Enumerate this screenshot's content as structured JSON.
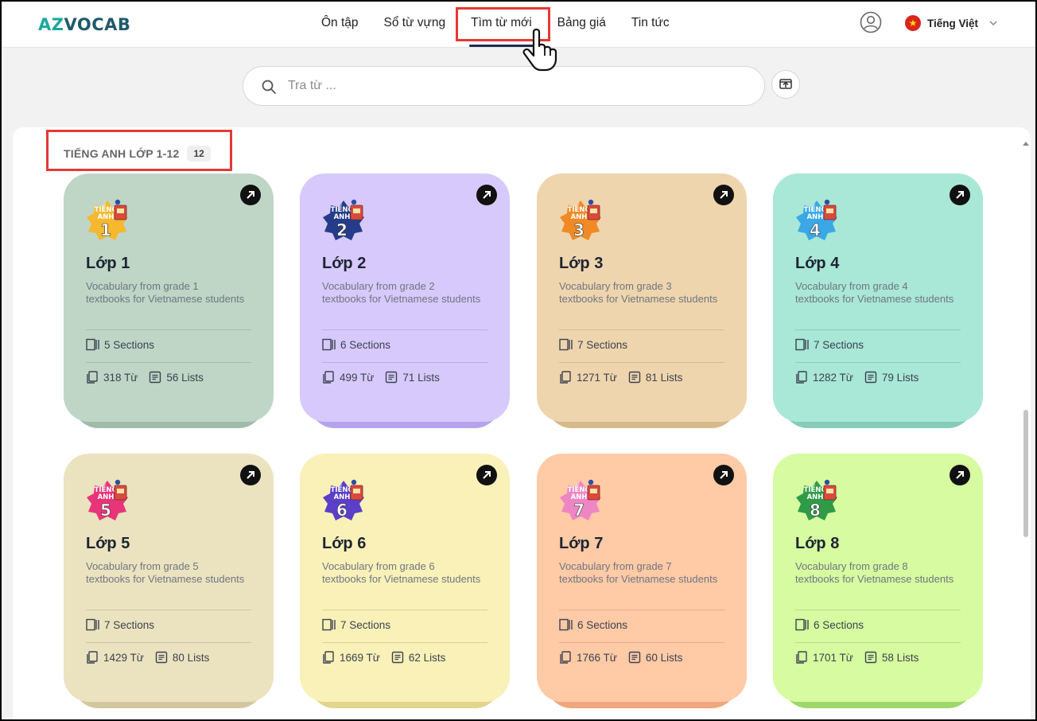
{
  "header": {
    "logo": "AZVOCAB",
    "nav": [
      {
        "label": "Ôn tập"
      },
      {
        "label": "Sổ từ vựng"
      },
      {
        "label": "Tìm từ mới",
        "active": true
      },
      {
        "label": "Bảng giá"
      },
      {
        "label": "Tin tức"
      }
    ],
    "language": "Tiếng Việt"
  },
  "search": {
    "placeholder": "Tra từ ..."
  },
  "section": {
    "title": "TIẾNG ANH LỚP 1-12",
    "count": "12"
  },
  "cards": [
    {
      "title": "Lớp 1",
      "grade": "1",
      "desc": "Vocabulary from grade 1 textbooks for Vietnamese students",
      "sections": "5 Sections",
      "words": "318 Từ",
      "lists": "56 Lists",
      "color": "#bfd6c6",
      "shadow": "#9fbba9",
      "badge": "#f5b82e"
    },
    {
      "title": "Lớp 2",
      "grade": "2",
      "desc": "Vocabulary from grade 2 textbooks for Vietnamese students",
      "sections": "6 Sections",
      "words": "499 Từ",
      "lists": "71 Lists",
      "color": "#d7c9fb",
      "shadow": "#b6a3ee",
      "badge": "#243c8a"
    },
    {
      "title": "Lớp 3",
      "grade": "3",
      "desc": "Vocabulary from grade 3 textbooks for Vietnamese students",
      "sections": "7 Sections",
      "words": "1271 Từ",
      "lists": "81 Lists",
      "color": "#efd5ad",
      "shadow": "#d8b98a",
      "badge": "#f08a24"
    },
    {
      "title": "Lớp 4",
      "grade": "4",
      "desc": "Vocabulary from grade 4 textbooks for Vietnamese students",
      "sections": "7 Sections",
      "words": "1282 Từ",
      "lists": "79 Lists",
      "color": "#a9e7d6",
      "shadow": "#86cdb9",
      "badge": "#3aa8e6"
    },
    {
      "title": "Lớp 5",
      "grade": "5",
      "desc": "Vocabulary from grade 5 textbooks for Vietnamese students",
      "sections": "7 Sections",
      "words": "1429 Từ",
      "lists": "80 Lists",
      "color": "#ebe3bf",
      "shadow": "#d2c79c",
      "badge": "#e8357a"
    },
    {
      "title": "Lớp 6",
      "grade": "6",
      "desc": "Vocabulary from grade 6 textbooks for Vietnamese students",
      "sections": "7 Sections",
      "words": "1669 Từ",
      "lists": "62 Lists",
      "color": "#f9f1b8",
      "shadow": "#e2d58c",
      "badge": "#5b3fc8"
    },
    {
      "title": "Lớp 7",
      "grade": "7",
      "desc": "Vocabulary from grade 7 textbooks for Vietnamese students",
      "sections": "6 Sections",
      "words": "1766 Từ",
      "lists": "60 Lists",
      "color": "#ffcaa6",
      "shadow": "#f0a77c",
      "badge": "#ef86c4"
    },
    {
      "title": "Lớp 8",
      "grade": "8",
      "desc": "Vocabulary from grade 8 textbooks for Vietnamese students",
      "sections": "6 Sections",
      "words": "1701 Từ",
      "lists": "58 Lists",
      "color": "#d7fba0",
      "shadow": "#9fd86a",
      "badge": "#2f9b46"
    }
  ]
}
